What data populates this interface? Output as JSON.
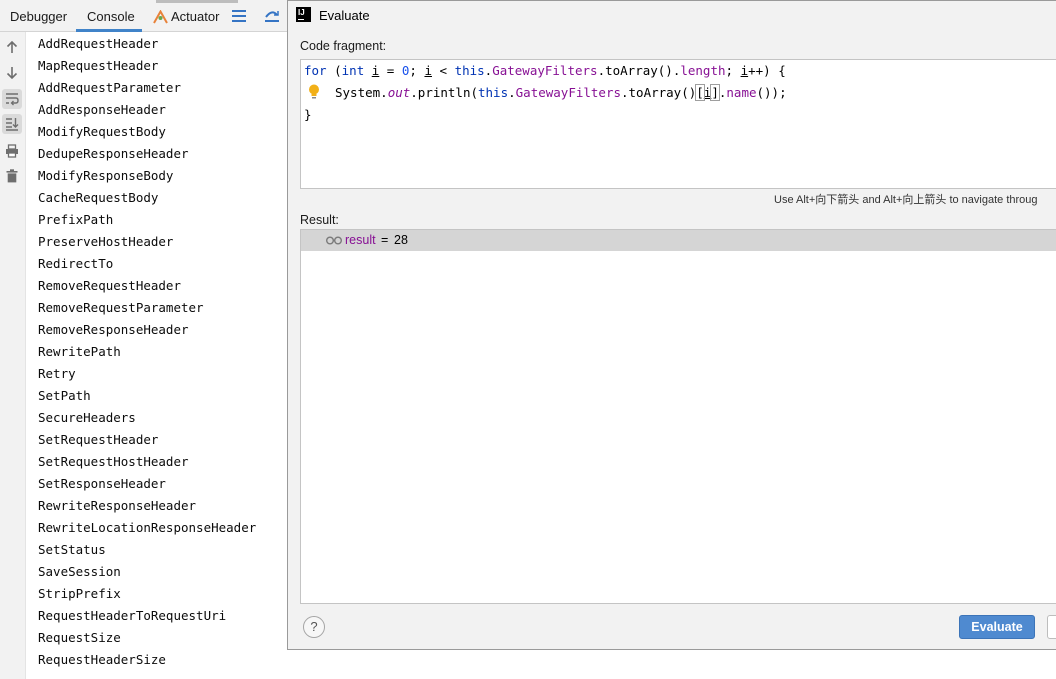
{
  "ide": {
    "tabs": {
      "debugger": "Debugger",
      "console": "Console",
      "actuator": "Actuator"
    },
    "active_tab": "Console",
    "console_lines": [
      "AddRequestHeader",
      "MapRequestHeader",
      "AddRequestParameter",
      "AddResponseHeader",
      "ModifyRequestBody",
      "DedupeResponseHeader",
      "ModifyResponseBody",
      "CacheRequestBody",
      "PrefixPath",
      "PreserveHostHeader",
      "RedirectTo",
      "RemoveRequestHeader",
      "RemoveRequestParameter",
      "RemoveResponseHeader",
      "RewritePath",
      "Retry",
      "SetPath",
      "SecureHeaders",
      "SetRequestHeader",
      "SetRequestHostHeader",
      "SetResponseHeader",
      "RewriteResponseHeader",
      "RewriteLocationResponseHeader",
      "SetStatus",
      "SaveSession",
      "StripPrefix",
      "RequestHeaderToRequestUri",
      "RequestSize",
      "RequestHeaderSize"
    ],
    "gutter_icons": [
      "arrow-up-icon",
      "arrow-down-icon",
      "soft-wrap-icon",
      "scroll-to-end-icon",
      "print-icon",
      "trash-icon"
    ]
  },
  "dialog": {
    "title": "Evaluate",
    "code_label": "Code fragment:",
    "code": {
      "line1": {
        "for": "for",
        "paren_open": " (",
        "int": "int",
        "sp": " ",
        "i1": "i",
        "eq": " = ",
        "zero": "0",
        "semi": "; ",
        "i2": "i",
        "lt": " < ",
        "this": "this",
        "dot1": ".",
        "field": "GatewayFilters",
        "call": ".toArray().",
        "length": "length",
        "semi2": "; ",
        "i3": "i",
        "tail": "++) {"
      },
      "line2": {
        "system": "System.",
        "out": "out",
        "println": ".println(",
        "this": "this",
        "dot1": ".",
        "field": "GatewayFilters",
        "call": ".toArray()",
        "lbr": "[",
        "i": "i",
        "rbr": "]",
        "dot2": ".",
        "name": "name",
        "tail": "());"
      },
      "line3": "}"
    },
    "hint": "Use Alt+向下箭头 and Alt+向上箭头 to navigate throug",
    "result_label": "Result:",
    "result": {
      "name": "result",
      "eq": "=",
      "value": "28"
    },
    "help_label": "?",
    "evaluate_label": "Evaluate"
  },
  "colors": {
    "keyword": "#0033b3",
    "number": "#1750eb",
    "field": "#871094",
    "evaluate_button": "#4f8ad0",
    "console_underline": "#4083c9"
  }
}
